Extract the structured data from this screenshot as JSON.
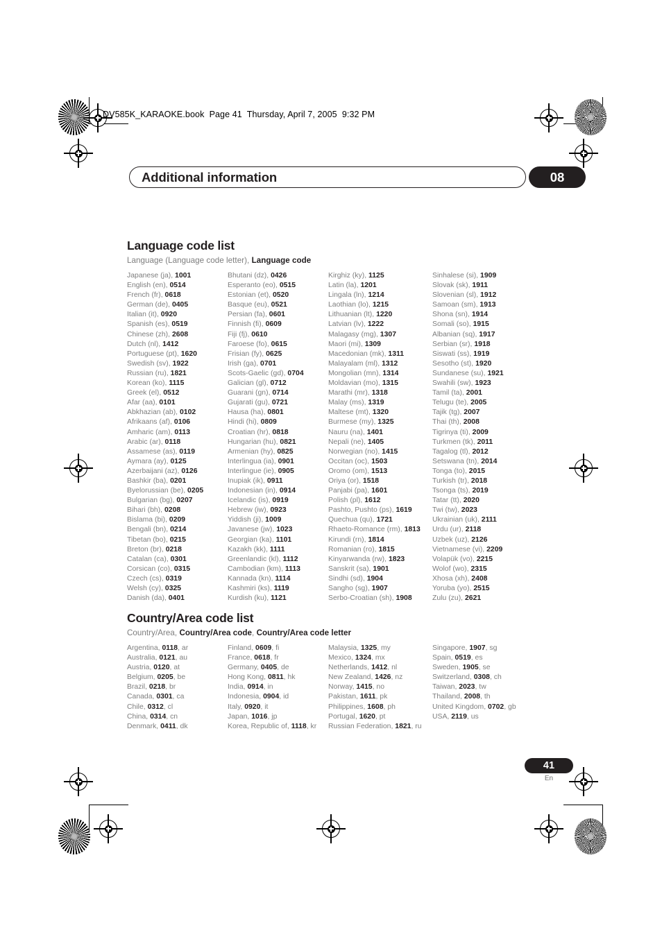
{
  "book_header": "DV585K_KARAOKE.book  Page 41  Thursday, April 7, 2005  9:32 PM",
  "chapter": {
    "title": "Additional information",
    "number": "08"
  },
  "language_section": {
    "heading": "Language code list",
    "legend_plain_1": "Language (Language code letter), ",
    "legend_bold_1": "Language code",
    "columns": [
      [
        "Japanese (ja), |1001",
        "English (en), |0514",
        "French (fr), |0618",
        "German (de), |0405",
        "Italian (it), |0920",
        "Spanish (es), |0519",
        "Chinese (zh), |2608",
        "Dutch (nl), |1412",
        "Portuguese (pt), |1620",
        "Swedish (sv), |1922",
        "Russian (ru), |1821",
        "Korean (ko), |1115",
        "Greek (el), |0512",
        "Afar (aa), |0101",
        "Abkhazian (ab), |0102",
        "Afrikaans (af), |0106",
        "Amharic (am), |0113",
        "Arabic (ar), |0118",
        "Assamese (as), |0119",
        "Aymara (ay), |0125",
        "Azerbaijani (az), |0126",
        "Bashkir (ba), |0201",
        "Byelorussian (be), |0205",
        "Bulgarian (bg), |0207",
        "Bihari (bh), |0208",
        "Bislama (bi), |0209",
        "Bengali (bn), |0214",
        "Tibetan (bo), |0215",
        "Breton (br), |0218",
        "Catalan (ca), |0301",
        "Corsican (co), |0315",
        "Czech (cs), |0319",
        "Welsh (cy), |0325",
        "Danish (da), |0401"
      ],
      [
        "Bhutani (dz), |0426",
        "Esperanto (eo), |0515",
        "Estonian (et), |0520",
        "Basque (eu), |0521",
        "Persian (fa), |0601",
        "Finnish (fi), |0609",
        "Fiji (fj), |0610",
        "Faroese (fo), |0615",
        "Frisian (fy), |0625",
        "Irish (ga), |0701",
        "Scots-Gaelic (gd), |0704",
        "Galician (gl), |0712",
        "Guarani (gn), |0714",
        "Gujarati (gu), |0721",
        "Hausa (ha), |0801",
        "Hindi (hi), |0809",
        "Croatian (hr), |0818",
        "Hungarian (hu), |0821",
        "Armenian (hy), |0825",
        "Interlingua (ia), |0901",
        "Interlingue (ie), |0905",
        "Inupiak (ik), |0911",
        "Indonesian (in), |0914",
        "Icelandic (is), |0919",
        "Hebrew (iw), |0923",
        "Yiddish (ji), |1009",
        "Javanese (jw), |1023",
        "Georgian (ka), |1101",
        "Kazakh (kk), |1111",
        "Greenlandic  (kl), |1112",
        "Cambodian (km), |1113",
        "Kannada (kn), |1114",
        "Kashmiri (ks), |1119",
        "Kurdish (ku), |1121"
      ],
      [
        "Kirghiz (ky), |1125",
        "Latin (la), |1201",
        "Lingala (ln), |1214",
        "Laothian (lo), |1215",
        "Lithuanian (lt), |1220",
        "Latvian (lv), |1222",
        "Malagasy (mg), |1307",
        "Maori (mi), |1309",
        "Macedonian (mk), |1311",
        "Malayalam  (ml), |1312",
        "Mongolian (mn), |1314",
        "Moldavian (mo), |1315",
        "Marathi (mr), |1318",
        "Malay  (ms), |1319",
        "Maltese (mt), |1320",
        "Burmese (my), |1325",
        "Nauru (na), |1401",
        "Nepali (ne), |1405",
        "Norwegian (no), |1415",
        "Occitan (oc), |1503",
        "Oromo (om), |1513",
        "Oriya (or), |1518",
        "Panjabi (pa), |1601",
        "Polish (pl), |1612",
        "Pashto, Pushto (ps), |1619",
        "Quechua (qu), |1721",
        "Rhaeto-Romance (rm), |1813",
        "Kirundi (rn), |1814",
        "Romanian (ro), |1815",
        "Kinyarwanda (rw), |1823",
        "Sanskrit (sa), |1901",
        "Sindhi (sd), |1904",
        "Sangho (sg), |1907",
        "Serbo-Croatian (sh), |1908"
      ],
      [
        "Sinhalese (si), |1909",
        "Slovak (sk), |1911",
        "Slovenian (sl), |1912",
        "Samoan (sm), |1913",
        "Shona (sn), |1914",
        "Somali (so), |1915",
        "Albanian (sq), |1917",
        "Serbian (sr), |1918",
        "Siswati (ss), |1919",
        "Sesotho (st), |1920",
        "Sundanese (su), |1921",
        "Swahili (sw), |1923",
        "Tamil (ta), |2001",
        "Telugu (te), |2005",
        "Tajik (tg), |2007",
        "Thai (th), |2008",
        "Tigrinya (ti), |2009",
        "Turkmen (tk), |2011",
        "Tagalog (tl), |2012",
        "Setswana (tn), |2014",
        "Tonga (to), |2015",
        "Turkish (tr), |2018",
        "Tsonga (ts), |2019",
        "Tatar (tt), |2020",
        "Twi (tw), |2023",
        "Ukrainian (uk), |2111",
        "Urdu (ur), |2118",
        "Uzbek (uz), |2126",
        "Vietnamese (vi), |2209",
        "Volapük (vo), |2215",
        "Wolof (wo), |2315",
        "Xhosa (xh), |2408",
        "Yoruba (yo), |2515",
        "Zulu (zu), |2621"
      ]
    ]
  },
  "country_section": {
    "heading": "Country/Area code list",
    "legend_plain_1": "Country/Area, ",
    "legend_bold_1": "Country/Area code",
    "legend_plain_2": ", ",
    "legend_bold_2": "Country/Area code letter",
    "columns": [
      [
        "Argentina, |0118|, ar",
        "Australia, |0121|, au",
        "Austria, |0120|, at",
        "Belgium, |0205|, be",
        "Brazil, |0218|, br",
        "Canada, |0301|, ca",
        "Chile, |0312|, cl",
        "China, |0314|, cn",
        "Denmark, |0411|, dk"
      ],
      [
        "Finland, |0609|, fi",
        "France, |0618|, fr",
        "Germany, |0405|, de",
        "Hong Kong, |0811|, hk",
        "India, |0914|, in",
        "Indonesia, |0904|, id",
        "Italy, |0920|, it",
        "Japan, |1016|, jp",
        "Korea, Republic of, |1118|, kr"
      ],
      [
        "Malaysia, |1325|, my",
        "Mexico, |1324|, mx",
        "Netherlands, |1412|, nl",
        "New Zealand, |1426|, nz",
        "Norway, |1415|, no",
        "Pakistan, |1611|, pk",
        "Philippines, |1608|, ph",
        "Portugal, |1620|, pt",
        "Russian Federation, |1821|, ru"
      ],
      [
        "Singapore, |1907|, sg",
        "Spain, |0519|, es",
        "Sweden, |1905|, se",
        "Switzerland, |0308|, ch",
        "Taiwan, |2023|, tw",
        "Thailand, |2008|, th",
        "United Kingdom, |0702|, gb",
        "USA, |2119|, us"
      ]
    ]
  },
  "footer": {
    "page_number": "41",
    "language_mark": "En"
  }
}
